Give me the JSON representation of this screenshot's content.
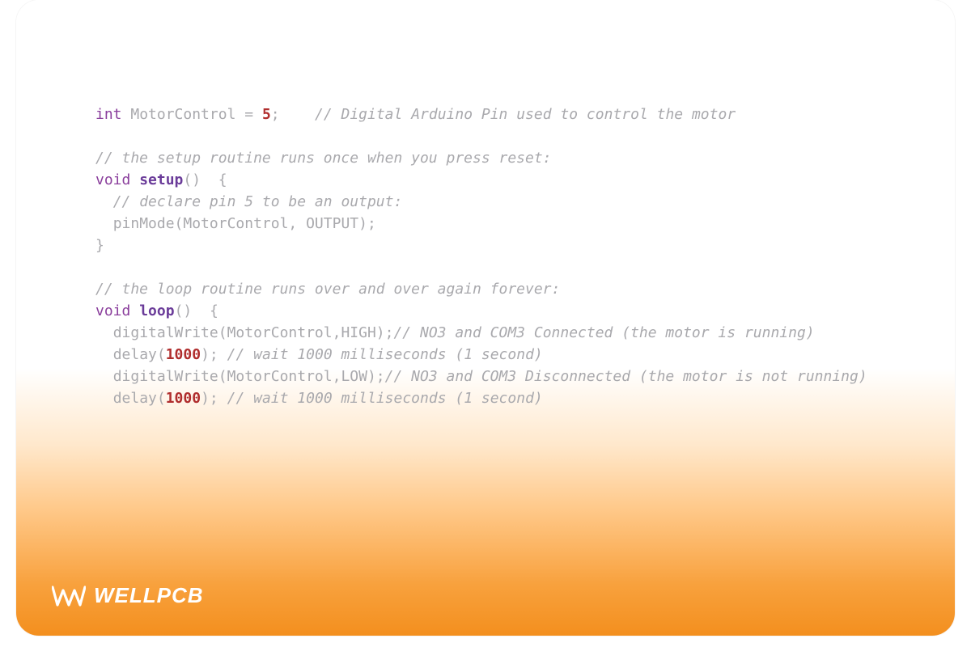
{
  "logo": {
    "text": "WELLPCB"
  },
  "code": {
    "l1": {
      "kw": "int",
      "sp1": " ",
      "id": "MotorControl",
      "sp2": " ",
      "eq": "=",
      "sp3": " ",
      "num": "5",
      "semi": ";",
      "gap": "    ",
      "cm": "// Digital Arduino Pin used to control the motor"
    },
    "l3": {
      "cm": "// the setup routine runs once when you press reset:"
    },
    "l4": {
      "kw": "void",
      "sp": " ",
      "fn": "setup",
      "pn": "()",
      "sp2": "  ",
      "br": "{"
    },
    "l5": {
      "indent": "  ",
      "cm": "// declare pin 5 to be an output:"
    },
    "l6": {
      "indent": "  ",
      "call": "pinMode(MotorControl, OUTPUT);"
    },
    "l7": {
      "br": "}"
    },
    "l9": {
      "cm": "// the loop routine runs over and over again forever:"
    },
    "l10": {
      "kw": "void",
      "sp": " ",
      "fn": "loop",
      "pn": "()",
      "sp2": "  ",
      "br": "{"
    },
    "l11": {
      "indent": "  ",
      "call": "digitalWrite(MotorControl,HIGH);",
      "cm": "// NO3 and COM3 Connected (the motor is running)"
    },
    "l12": {
      "indent": "  ",
      "call1": "delay(",
      "num": "1000",
      "call2": ");",
      "sp": " ",
      "cm": "// wait 1000 milliseconds (1 second)"
    },
    "l13": {
      "indent": "  ",
      "call": "digitalWrite(MotorControl,LOW);",
      "cm": "// NO3 and COM3 Disconnected (the motor is not running)"
    },
    "l14": {
      "indent": "  ",
      "call1": "delay(",
      "num": "1000",
      "call2": ");",
      "sp": " ",
      "cm": "// wait 1000 milliseconds (1 second)"
    }
  }
}
